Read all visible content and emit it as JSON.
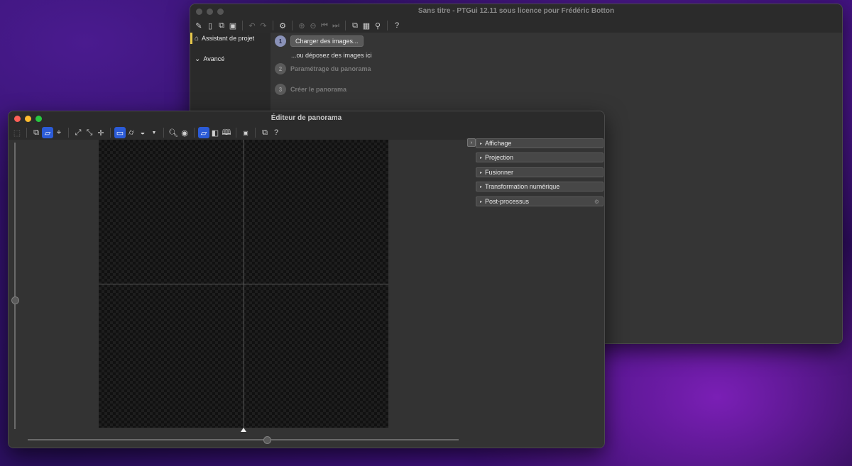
{
  "main_window": {
    "title": "Sans titre - PTGui 12.11 sous licence pour Frédéric Botton",
    "sidebar": {
      "items": [
        {
          "label": "Assistant de projet",
          "icon": "home-icon",
          "active": true
        },
        {
          "label": "Avancé",
          "icon": "chevron-down-circle-icon",
          "active": false
        }
      ]
    },
    "steps": {
      "s1": {
        "num": "1",
        "button": "Charger des images...",
        "hint": "...ou déposez des images ici"
      },
      "s2": {
        "num": "2",
        "label": "Paramétrage du panorama"
      },
      "s3": {
        "num": "3",
        "label": "Créer le panorama"
      }
    }
  },
  "editor_window": {
    "title": "Éditeur de panorama",
    "panel_sections": [
      {
        "label": "Affichage"
      },
      {
        "label": "Projection"
      },
      {
        "label": "Fusionner"
      },
      {
        "label": "Transformation numérique"
      },
      {
        "label": "Post-processus"
      }
    ]
  },
  "colors": {
    "accent": "#2b5bd7",
    "sidebar_active": "#e5c64a"
  }
}
